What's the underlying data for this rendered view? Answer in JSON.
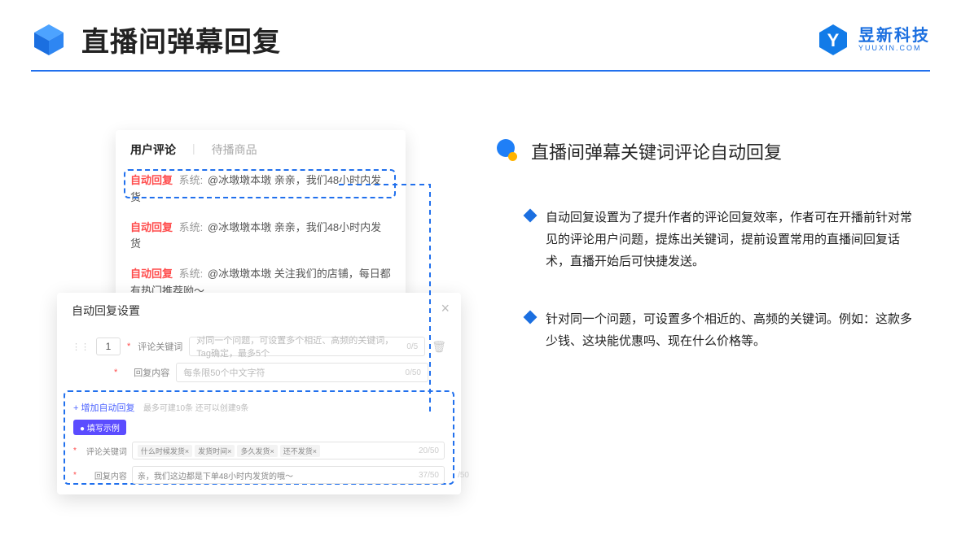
{
  "header": {
    "title": "直播间弹幕回复",
    "brand_cn": "昱新科技",
    "brand_en": "YUUXIN.COM"
  },
  "comment_card": {
    "tab_active": "用户评论",
    "tab_inactive": "待播商品",
    "badge": "自动回复",
    "sys": "系统:",
    "line1": "@冰墩墩本墩 亲亲，我们48小时内发货",
    "line2": "@冰墩墩本墩 亲亲，我们48小时内发货",
    "line3": "@冰墩墩本墩 关注我们的店铺，每日都有热门推荐呦～"
  },
  "settings": {
    "title": "自动回复设置",
    "num": "1",
    "label_kw": "评论关键词",
    "placeholder_kw": "对同一个问题，可设置多个相近、高频的关键词，Tag确定，最多5个",
    "count_kw": "0/5",
    "label_reply": "回复内容",
    "placeholder_reply": "每条限50个中文字符",
    "count_reply": "0/50",
    "add_link": "+ 增加自动回复",
    "add_hint": "最多可建10条 还可以创建9条",
    "example_chip": "● 填写示例",
    "ex_kw_label": "评论关键词",
    "ex_tags": [
      "什么时候发货×",
      "发货时间×",
      "多久发货×",
      "还不发货×"
    ],
    "ex_kw_count": "20/50",
    "ex_reply_label": "回复内容",
    "ex_reply_val": "亲，我们这边都是下单48小时内发货的哦～",
    "ex_reply_count": "37/50",
    "tail_count": "/50"
  },
  "right": {
    "subhead": "直播间弹幕关键词评论自动回复",
    "bullets": [
      "自动回复设置为了提升作者的评论回复效率，作者可在开播前针对常见的评论用户问题，提炼出关键词，提前设置常用的直播间回复话术，直播开始后可快捷发送。",
      "针对同一个问题，可设置多个相近的、高频的关键词。例如：这款多少钱、这块能优惠吗、现在什么价格等。"
    ]
  }
}
